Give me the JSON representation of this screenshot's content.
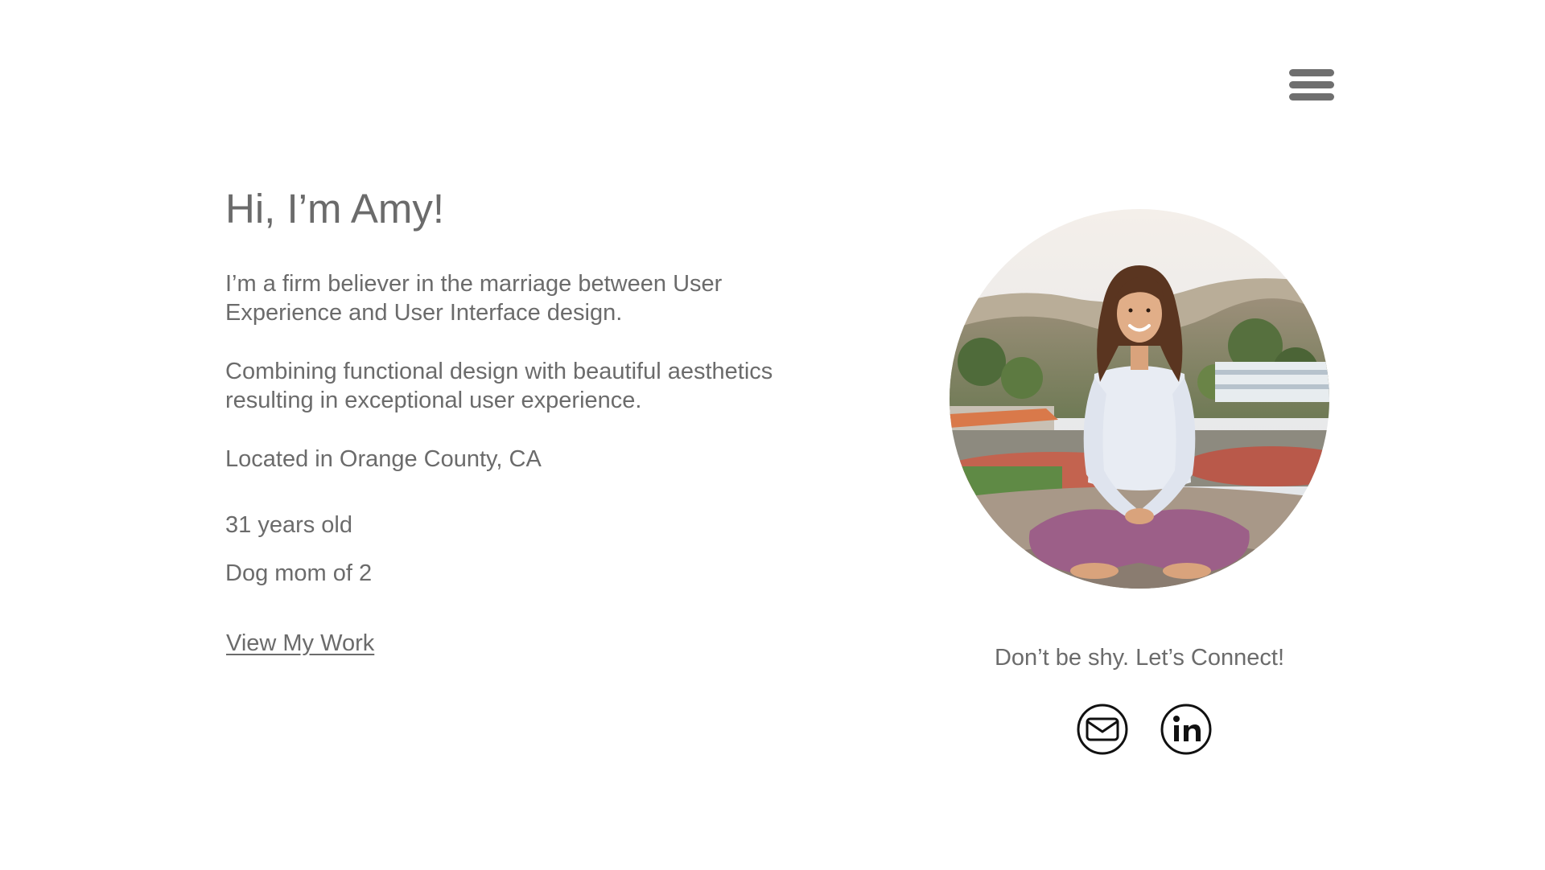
{
  "header": {
    "menu_icon": "hamburger-menu-icon"
  },
  "intro": {
    "greeting": "Hi, I’m Amy!",
    "belief_line1": "I’m a firm believer in the marriage between User",
    "belief_line2": "Experience and User Interface design.",
    "combine_line1": "Combining functional design with beautiful aesthetics",
    "combine_line2": "resulting in exceptional user experience.",
    "location": "Located in Orange County, CA",
    "age": "31 years old",
    "dogs": "Dog mom of 2",
    "view_work_label": "View My Work"
  },
  "portrait": {
    "alt": "Portrait of Amy sitting cross-legged outdoors"
  },
  "connect": {
    "heading": "Don’t be shy. Let’s Connect!",
    "email_icon": "email-icon",
    "linkedin_icon": "linkedin-icon"
  },
  "colors": {
    "text": "#6b6b6b",
    "menu": "#6f6f6f",
    "icon_stroke": "#111111",
    "background": "#ffffff"
  }
}
